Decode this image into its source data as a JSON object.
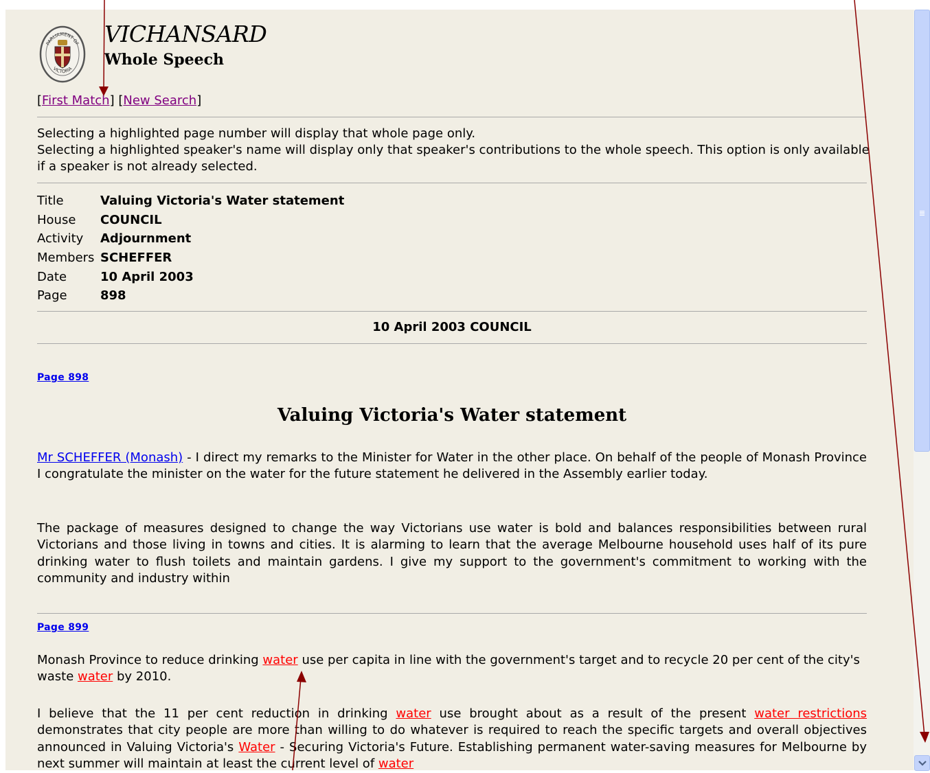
{
  "header": {
    "site_title": "VICHANSARD",
    "subtitle": "Whole Speech",
    "logo_icon": "parliament-of-victoria-seal",
    "logo_text_top": "PARLIAMENT OF",
    "logo_text_bottom": "VICTORIA"
  },
  "nav": {
    "bracket_open": "[",
    "bracket_close": "]",
    "first_match": "First Match",
    "new_search": "New Search"
  },
  "notes": {
    "line1": "Selecting a highlighted page number will display that whole page only.",
    "line2": "Selecting a highlighted speaker's name will display only that speaker's contributions to the whole speech. This option is only available if a speaker is not already selected."
  },
  "meta": [
    {
      "label": "Title",
      "value": "Valuing Victoria's Water statement"
    },
    {
      "label": "House",
      "value": "COUNCIL"
    },
    {
      "label": "Activity",
      "value": "Adjournment"
    },
    {
      "label": "Members",
      "value": "SCHEFFER"
    },
    {
      "label": "Date",
      "value": "10 April 2003"
    },
    {
      "label": "Page",
      "value": "898"
    }
  ],
  "date_header": "10 April 2003 COUNCIL",
  "page_links": [
    "Page 898",
    "Page 899"
  ],
  "speech": {
    "title": "Valuing Victoria's Water statement",
    "speaker": "Mr SCHEFFER (Monash)",
    "p1": " - I direct my remarks to the Minister for Water in the other place. On behalf of the people of Monash Province I congratulate the minister on the water for the future statement he delivered in the Assembly earlier today.",
    "p2": "The package of measures designed to change the way Victorians use water is bold and balances responsibilities between rural Victorians and those living in towns and cities. It is alarming to learn that the average Melbourne household uses half of its pure drinking water to flush toilets and maintain gardens. I give my support to the government's commitment to working with the community and industry within",
    "p3": [
      "Monash Province to reduce drinking ",
      "water",
      " use per capita in line with the government's target and to recycle 20 per cent of the city's waste ",
      "water",
      " by 2010."
    ],
    "p4": [
      "I believe that the 11 per cent reduction in drinking ",
      "water",
      " use brought about as a result of the present ",
      "water restrictions",
      " demonstrates that city people are more than willing to do whatever is required to reach the specific targets and overall objectives announced in Valuing Victoria's ",
      "Water",
      " - Securing Victoria's Future. Establishing permanent water-saving measures for Melbourne by next summer will maintain at least the current level of ",
      "water"
    ]
  },
  "colors": {
    "page_bg": "#f1eee4",
    "highlight": "#ff0000",
    "link": "#0000ee",
    "visited_link": "#800080",
    "annotation_arrow": "#8b0000",
    "scrollbar": "#c4d4fb"
  }
}
